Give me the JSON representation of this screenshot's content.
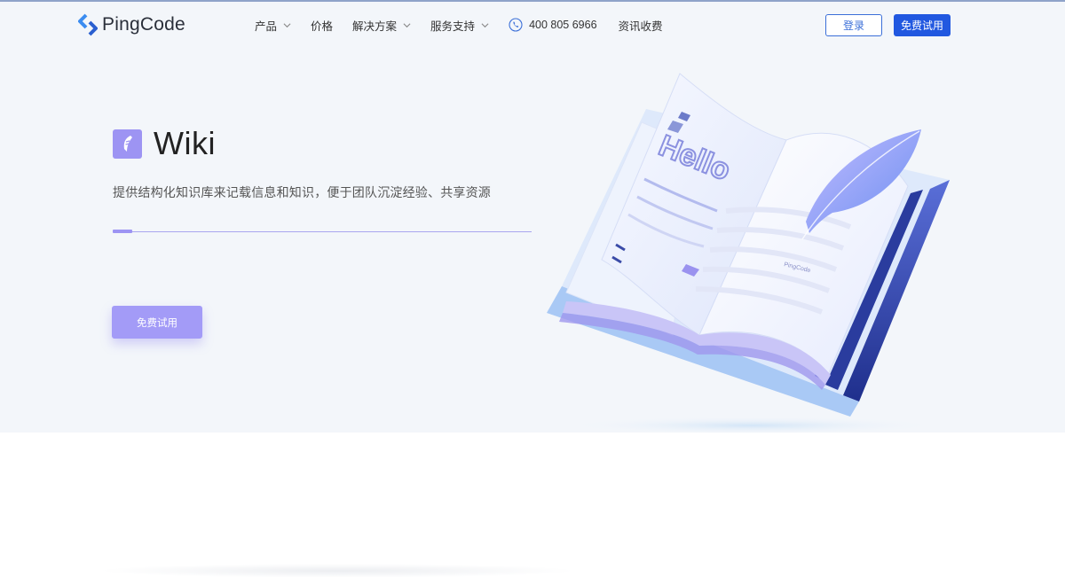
{
  "brand": {
    "name": "PingCode"
  },
  "nav": {
    "items": [
      {
        "label": "产品",
        "has_dropdown": true
      },
      {
        "label": "价格",
        "has_dropdown": false
      },
      {
        "label": "解决方案",
        "has_dropdown": true
      },
      {
        "label": "服务支持",
        "has_dropdown": true
      }
    ],
    "phone": "400 805 6966",
    "consult": "资讯收费",
    "login_label": "登录",
    "trial_label": "免费试用"
  },
  "hero": {
    "product_name": "Wiki",
    "description": "提供结构化知识库来记载信息和知识，便于团队沉淀经验、共享资源",
    "progress": 0.047,
    "cta_label": "免费试用"
  },
  "illustration": {
    "page_text": "Hello",
    "page_brand": "PingCode"
  },
  "colors": {
    "hero_bg": "#f3f6fa",
    "primary": "#2158e0",
    "accent": "#9d94f3",
    "logo_blue": "#3b8cf0"
  },
  "icons": {
    "logo": "pingcode-logo-icon",
    "chevron": "chevron-down-icon",
    "phone": "phone-icon",
    "product": "wiki-feather-icon"
  }
}
